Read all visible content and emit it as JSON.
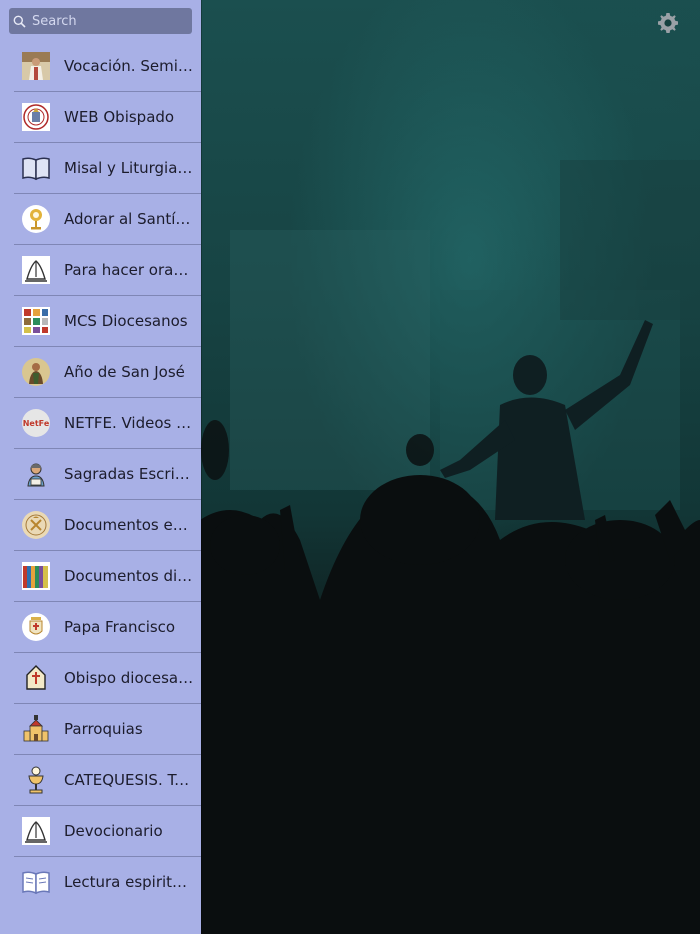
{
  "search": {
    "placeholder": "Search"
  },
  "settings": {
    "icon": "gear-icon"
  },
  "colors": {
    "sidebar_bg": "#a8b0e6",
    "search_bg": "#6f779f",
    "divider": "#7f86b5"
  },
  "menu": [
    {
      "label": "Vocación. Seminario",
      "icon": "vocation-icon"
    },
    {
      "label": "WEB Obispado",
      "icon": "bishopric-seal-icon"
    },
    {
      "label": "Misal y Liturgia de las Horas",
      "icon": "open-book-icon"
    },
    {
      "label": "Adorar al Santísimo",
      "icon": "monstrance-icon"
    },
    {
      "label": "Para hacer oración",
      "icon": "praying-hands-icon"
    },
    {
      "label": "MCS Diocesanos",
      "icon": "media-grid-icon"
    },
    {
      "label": "Año de San José",
      "icon": "saint-joseph-icon"
    },
    {
      "label": "NETFE. Videos y películas",
      "icon": "netfe-icon"
    },
    {
      "label": "Sagradas Escrituras",
      "icon": "person-reading-icon"
    },
    {
      "label": "Documentos esenciales",
      "icon": "vatican-seal-icon"
    },
    {
      "label": "Documentos diocesanos",
      "icon": "binders-icon"
    },
    {
      "label": "Papa Francisco",
      "icon": "pope-crest-icon"
    },
    {
      "label": "Obispo diocesano",
      "icon": "mitre-icon"
    },
    {
      "label": "Parroquias",
      "icon": "church-icon"
    },
    {
      "label": "CATEQUESIS. Temas",
      "icon": "chalice-icon"
    },
    {
      "label": "Devocionario",
      "icon": "praying-hands-icon"
    },
    {
      "label": "Lectura espiritual",
      "icon": "open-book-icon"
    }
  ]
}
